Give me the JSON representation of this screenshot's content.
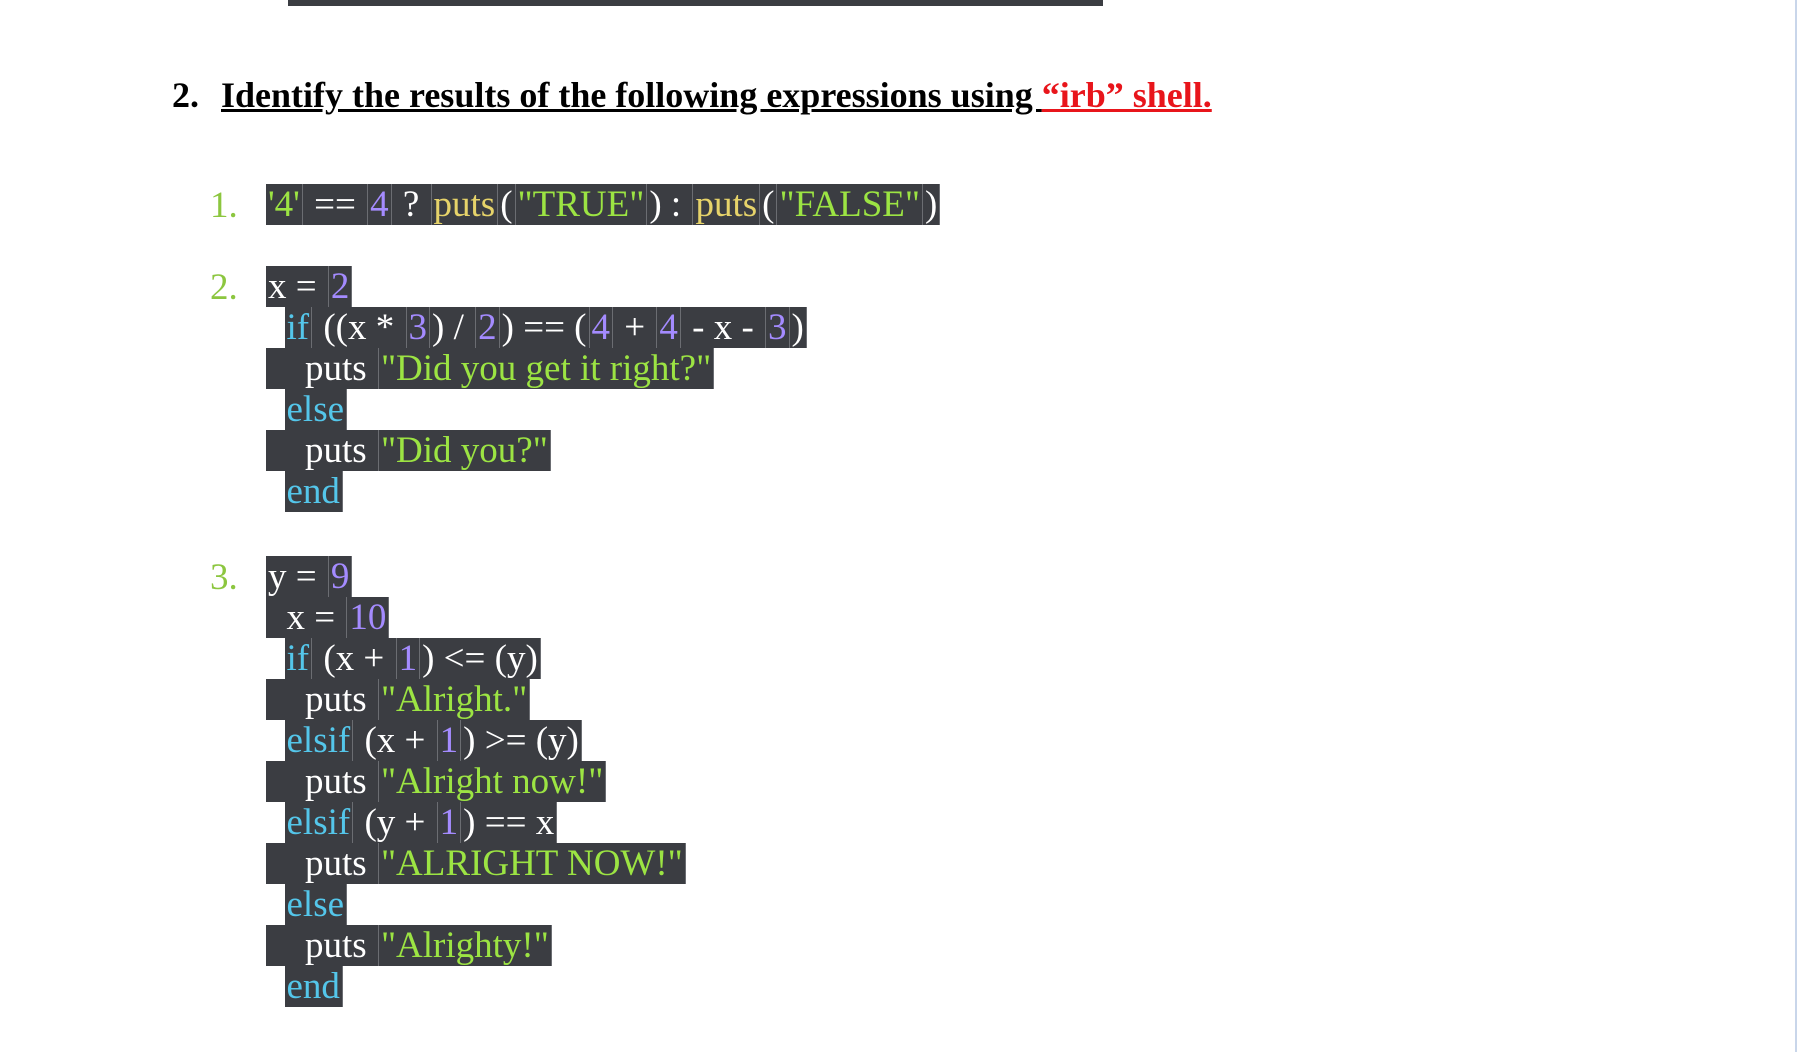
{
  "question": {
    "number": "2.",
    "text": "Identify the results of the following expressions using ",
    "highlight": "“irb” shell."
  },
  "items": [
    {
      "number": "1.",
      "lines": [
        [
          {
            "t": "'4'",
            "c": "str"
          },
          {
            "t": " == ",
            "c": "plain"
          },
          {
            "t": "4",
            "c": "num"
          },
          {
            "t": " ? ",
            "c": "plain"
          },
          {
            "t": "puts",
            "c": "fn"
          },
          {
            "t": "(",
            "c": "plain"
          },
          {
            "t": "\"TRUE\"",
            "c": "str"
          },
          {
            "t": ") : ",
            "c": "plain"
          },
          {
            "t": "puts",
            "c": "fn"
          },
          {
            "t": "(",
            "c": "plain"
          },
          {
            "t": "\"FALSE\"",
            "c": "str"
          },
          {
            "t": ")",
            "c": "plain"
          }
        ]
      ]
    },
    {
      "number": "2.",
      "lines": [
        [
          {
            "t": "x = ",
            "c": "plain"
          },
          {
            "t": "2",
            "c": "num"
          }
        ],
        [
          {
            "t": "  ",
            "c": "plain"
          },
          {
            "t": "if",
            "c": "kw"
          },
          {
            "t": " ((x * ",
            "c": "plain"
          },
          {
            "t": "3",
            "c": "num"
          },
          {
            "t": ") / ",
            "c": "plain"
          },
          {
            "t": "2",
            "c": "num"
          },
          {
            "t": ") == (",
            "c": "plain"
          },
          {
            "t": "4",
            "c": "num"
          },
          {
            "t": " + ",
            "c": "plain"
          },
          {
            "t": "4",
            "c": "num"
          },
          {
            "t": " - x - ",
            "c": "plain"
          },
          {
            "t": "3",
            "c": "num"
          },
          {
            "t": ")",
            "c": "plain"
          }
        ],
        [
          {
            "t": "    puts ",
            "c": "plain"
          },
          {
            "t": "\"Did you get it right?\"",
            "c": "str"
          }
        ],
        [
          {
            "t": "  ",
            "c": "plain"
          },
          {
            "t": "else",
            "c": "kw"
          }
        ],
        [
          {
            "t": "    puts ",
            "c": "plain"
          },
          {
            "t": "\"Did you?\"",
            "c": "str"
          }
        ],
        [
          {
            "t": "  ",
            "c": "plain"
          },
          {
            "t": "end",
            "c": "kw"
          }
        ]
      ]
    },
    {
      "number": "3.",
      "lines": [
        [
          {
            "t": "y = ",
            "c": "plain"
          },
          {
            "t": "9",
            "c": "num"
          }
        ],
        [
          {
            "t": "  x = ",
            "c": "plain"
          },
          {
            "t": "10",
            "c": "num"
          }
        ],
        [
          {
            "t": "  ",
            "c": "plain"
          },
          {
            "t": "if",
            "c": "kw"
          },
          {
            "t": " (x + ",
            "c": "plain"
          },
          {
            "t": "1",
            "c": "num"
          },
          {
            "t": ") <= (y)",
            "c": "plain"
          }
        ],
        [
          {
            "t": "    puts ",
            "c": "plain"
          },
          {
            "t": "\"Alright.\"",
            "c": "str"
          }
        ],
        [
          {
            "t": "  ",
            "c": "plain"
          },
          {
            "t": "elsif",
            "c": "kw"
          },
          {
            "t": " (x + ",
            "c": "plain"
          },
          {
            "t": "1",
            "c": "num"
          },
          {
            "t": ") >= (y)",
            "c": "plain"
          }
        ],
        [
          {
            "t": "    puts ",
            "c": "plain"
          },
          {
            "t": "\"Alright now!\"",
            "c": "str"
          }
        ],
        [
          {
            "t": "  ",
            "c": "plain"
          },
          {
            "t": "elsif",
            "c": "kw"
          },
          {
            "t": " (y + ",
            "c": "plain"
          },
          {
            "t": "1",
            "c": "num"
          },
          {
            "t": ") == x",
            "c": "plain"
          }
        ],
        [
          {
            "t": "    puts ",
            "c": "plain"
          },
          {
            "t": "\"ALRIGHT NOW!\"",
            "c": "str"
          }
        ],
        [
          {
            "t": "  ",
            "c": "plain"
          },
          {
            "t": "else",
            "c": "kw"
          }
        ],
        [
          {
            "t": "    puts ",
            "c": "plain"
          },
          {
            "t": "\"Alrighty!\"",
            "c": "str"
          }
        ],
        [
          {
            "t": "  ",
            "c": "plain"
          },
          {
            "t": "end",
            "c": "kw"
          }
        ]
      ]
    }
  ]
}
